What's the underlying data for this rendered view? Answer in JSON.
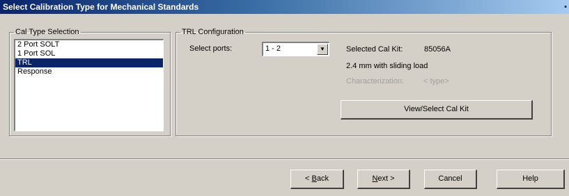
{
  "window": {
    "title": "Select Calibration Type for Mechanical Standards"
  },
  "cal_type_group": {
    "label": "Cal Type Selection",
    "items": [
      {
        "label": "2 Port SOLT",
        "selected": false
      },
      {
        "label": "1 Port SOL",
        "selected": false
      },
      {
        "label": "TRL",
        "selected": true
      },
      {
        "label": "Response",
        "selected": false
      }
    ]
  },
  "trl_group": {
    "label": "TRL Configuration",
    "select_ports_label": "Select ports:",
    "ports_value": "1 - 2",
    "selected_cal_kit_label": "Selected Cal Kit:",
    "selected_cal_kit_value": "85056A",
    "cal_kit_description": "2.4 mm with sliding load",
    "characterization_label": "Characterization:",
    "characterization_value": "< type>",
    "view_select_button": "View/Select Cal Kit"
  },
  "buttons": {
    "back_prefix": "< ",
    "back_mnemonic": "B",
    "back_rest": "ack",
    "next_mnemonic": "N",
    "next_rest": "ext >",
    "cancel": "Cancel",
    "help": "Help"
  },
  "colors": {
    "dialog_bg": "#d4d0c8",
    "selection": "#0a246a",
    "disabled_text": "#a0a0a0"
  }
}
